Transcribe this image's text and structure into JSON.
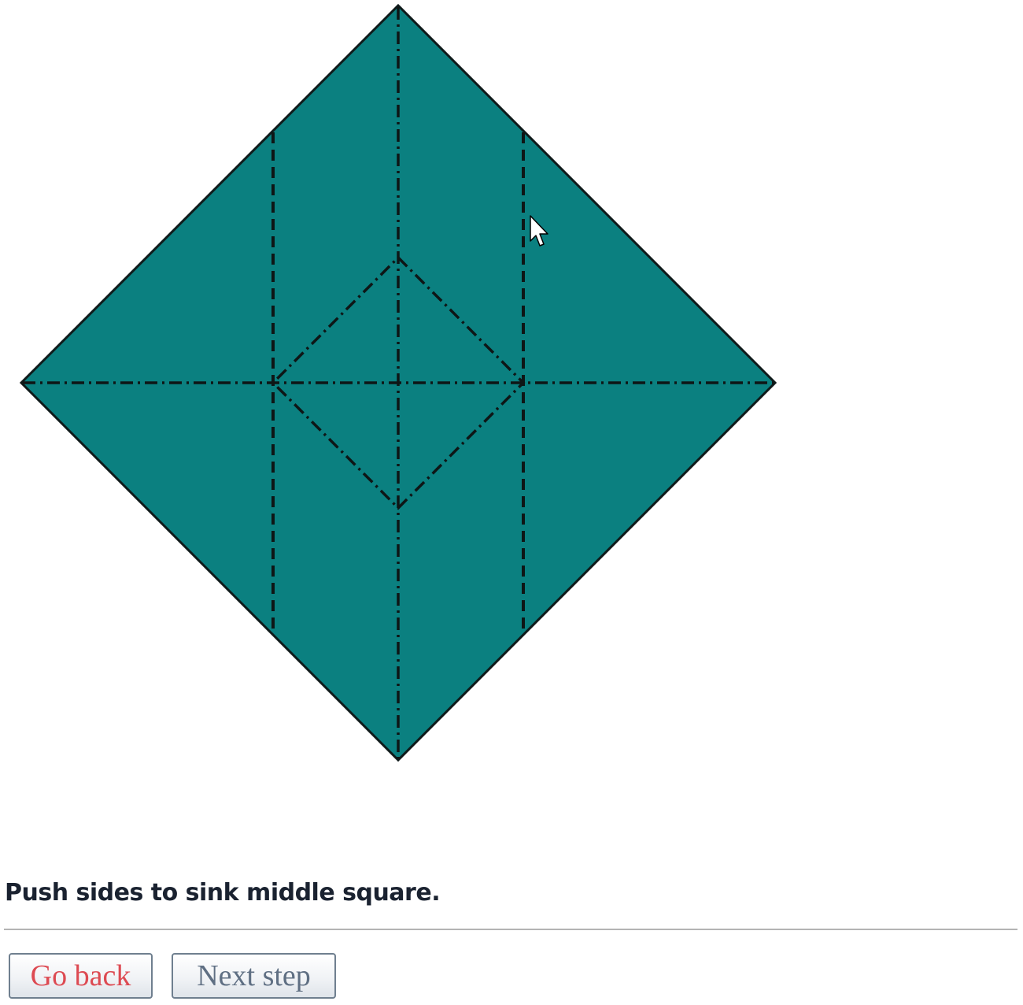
{
  "diagram": {
    "paper_color": "#0b8080",
    "outline_color": "#0f1a1a",
    "crease_color": "#0e1616"
  },
  "instruction": {
    "text": "Push sides to sink middle square."
  },
  "navigation": {
    "back_label": "Go back",
    "next_label": "Next step",
    "back_color": "#dd4a52",
    "next_color": "#5f6f83"
  },
  "cursor": {
    "icon": "arrow-pointer-icon"
  }
}
